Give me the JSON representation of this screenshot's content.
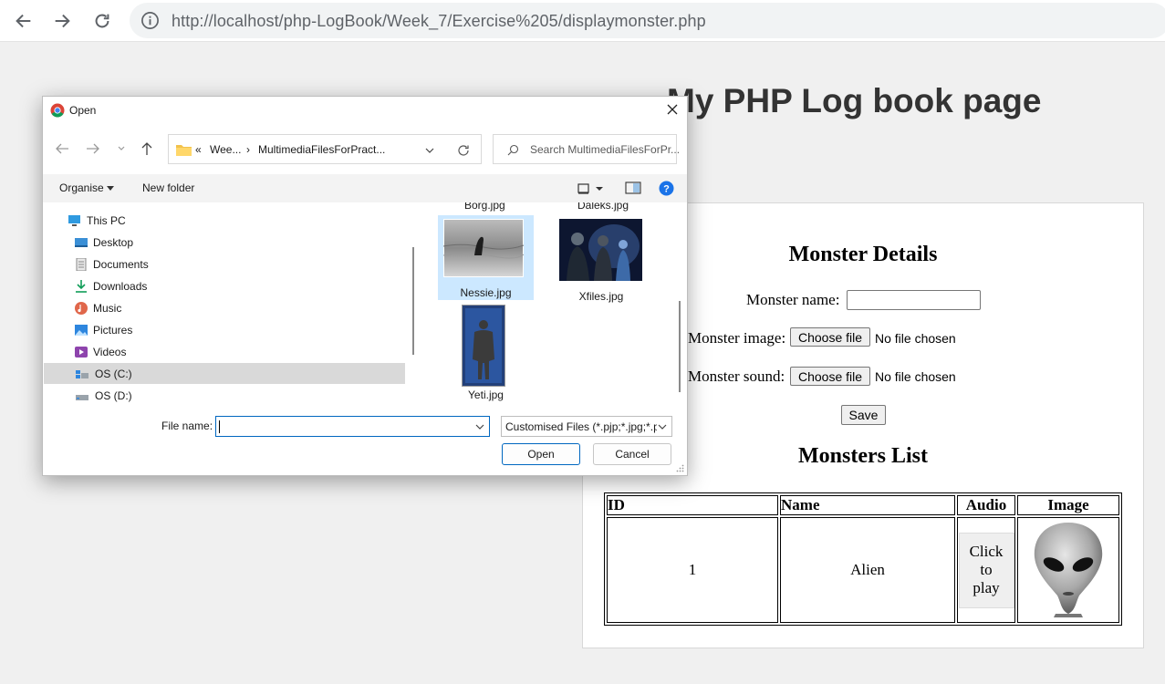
{
  "browser": {
    "url_host": "http://localhost",
    "url_path": "/php-LogBook/Week_7/Exercise%205/displaymonster.php"
  },
  "page": {
    "title": "My PHP Log book page",
    "form": {
      "heading": "Monster Details",
      "name_label": "Monster name:",
      "name_value": "",
      "image_label": "Monster image:",
      "sound_label": "Monster sound:",
      "choose_file": "Choose file",
      "no_file": "No file chosen",
      "save_label": "Save"
    },
    "list": {
      "heading": "Monsters List",
      "columns": [
        "ID",
        "Name",
        "Audio",
        "Image"
      ],
      "rows": [
        {
          "id": "1",
          "name": "Alien",
          "audio_label_lines": [
            "Click",
            "to",
            "play"
          ]
        }
      ]
    }
  },
  "dialog": {
    "title": "Open",
    "breadcrumb": [
      "«",
      "Wee...",
      "›",
      "MultimediaFilesForPract..."
    ],
    "search_placeholder": "Search MultimediaFilesForPr...",
    "organise_label": "Organise",
    "new_folder_label": "New folder",
    "nav_items": [
      "This PC",
      "Desktop",
      "Documents",
      "Downloads",
      "Music",
      "Pictures",
      "Videos",
      "OS (C:)",
      "OS (D:)"
    ],
    "selected_nav": "OS (C:)",
    "files": [
      "Borg.jpg",
      "Daleks.jpg",
      "Nessie.jpg",
      "Xfiles.jpg",
      "Yeti.jpg"
    ],
    "selected_file": "Nessie.jpg",
    "file_name_label": "File name:",
    "file_name_value": "",
    "file_type": "Customised Files (*.pjp;*.jpg;*.p",
    "open_label": "Open",
    "cancel_label": "Cancel"
  },
  "colors": {
    "accent": "#0067c0",
    "page_bg": "#f0f0f0",
    "selection": "#cce8ff"
  }
}
